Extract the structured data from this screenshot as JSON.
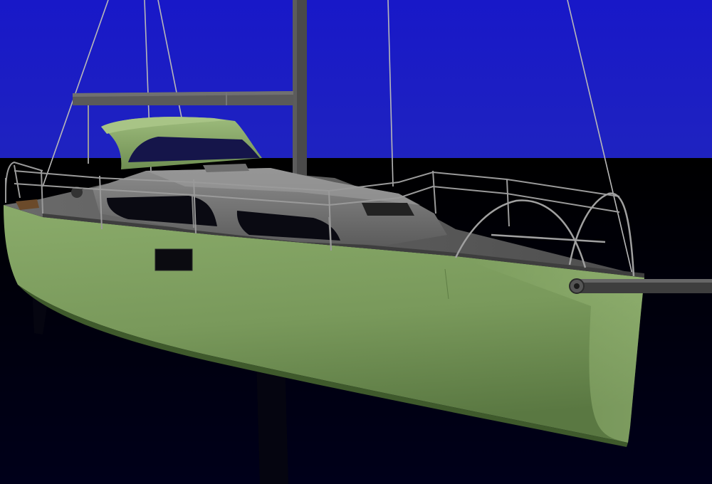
{
  "scene": {
    "subject": "sailboat-render",
    "colors": {
      "sky": "#1a1fc4",
      "water": "#000000",
      "hull": "#7a9a5c",
      "hull_shadow": "#4f6b3a",
      "deck": "#5e5e5e",
      "cabin": "#7d7d7d",
      "mast": "#4a4a4a",
      "rail": "#9a9a9a",
      "window": "#0a0a14"
    }
  }
}
